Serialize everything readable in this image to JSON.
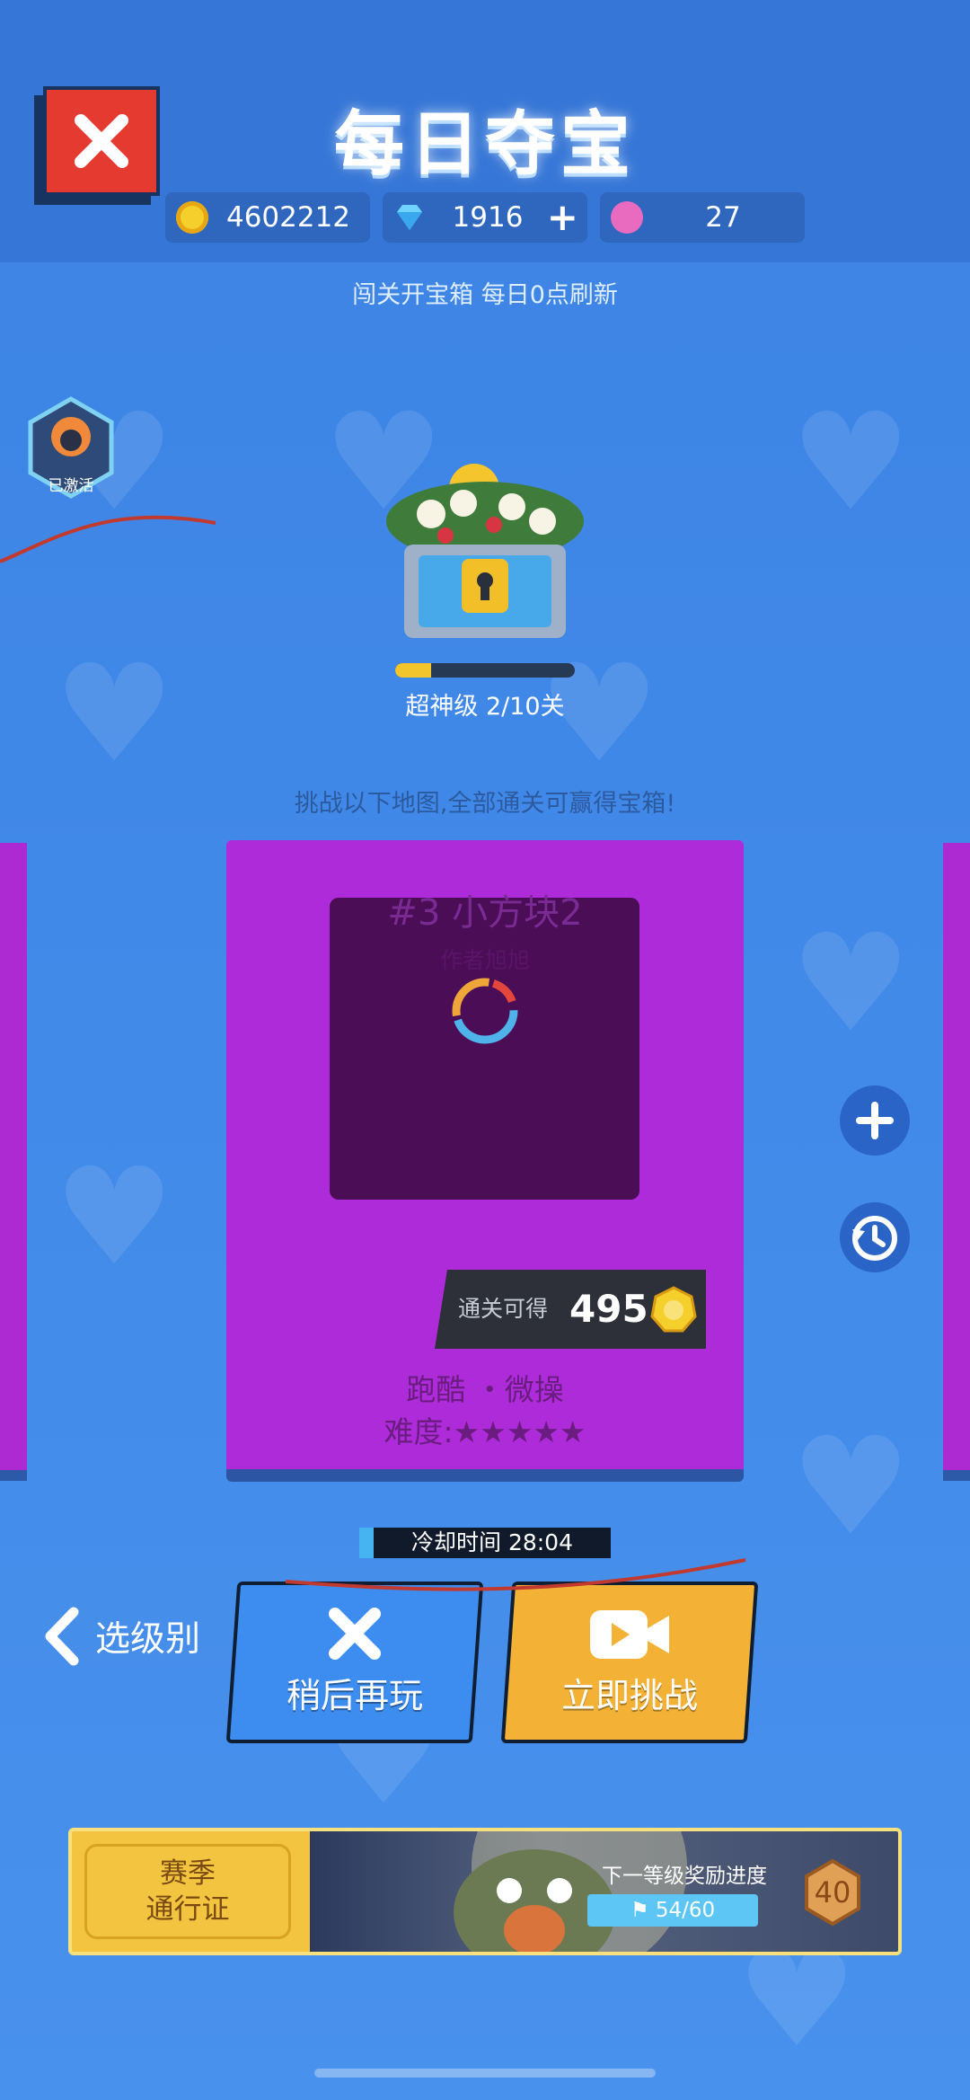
{
  "header": {
    "title": "每日夺宝",
    "coins": "4602212",
    "gems": "1916",
    "tokens": "27",
    "add_gems_symbol": "+"
  },
  "subtitle": "闯关开宝箱 每日0点刷新",
  "badge": {
    "label": "已激活"
  },
  "chest": {
    "level_label": "超神级 2/10关",
    "progress": 0.2
  },
  "hint": "挑战以下地图,全部通关可赢得宝箱!",
  "map_card": {
    "name": "#3 小方块2",
    "author": "作者旭旭",
    "reward_label": "通关可得",
    "reward_value": "495",
    "tags": "跑酷 ・微操",
    "difficulty_label": "难度:",
    "difficulty_stars": "★★★★★"
  },
  "cooldown": "冷却时间 28:04",
  "buttons": {
    "back": "选级别",
    "later": "稍后再玩",
    "challenge": "立即挑战"
  },
  "battle_pass": {
    "label_line1": "赛季",
    "label_line2": "通行证",
    "next_reward": "下一等级奖励进度",
    "progress": "54/60",
    "level": "40"
  },
  "colors": {
    "background": "#3f86e6",
    "card": "#ae2bd9",
    "later_button": "#3d8cf0",
    "challenge_button": "#f3b236",
    "close_button": "#e53a2f"
  },
  "icons": [
    "close-icon",
    "coin-icon",
    "gem-icon",
    "token-icon",
    "plus-icon",
    "history-icon",
    "video-icon",
    "chevron-left-icon",
    "flag-icon"
  ]
}
